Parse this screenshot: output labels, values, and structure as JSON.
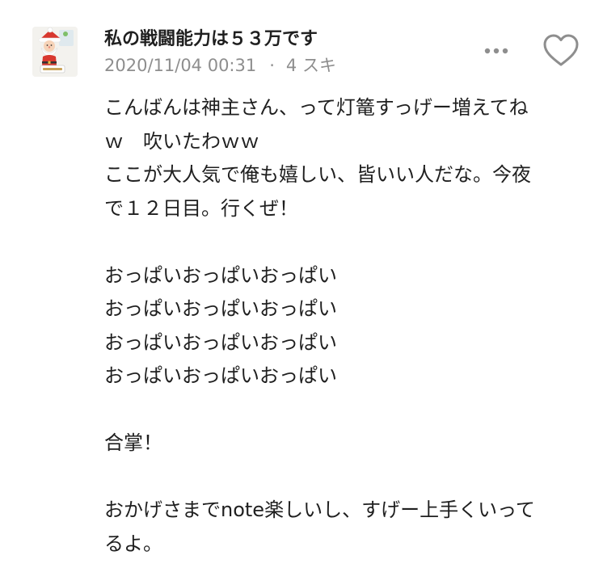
{
  "comment": {
    "author_name": "私の戦闘能力は５３万です",
    "timestamp": "2020/11/04 00:31",
    "separator": "·",
    "likes_label": "4 スキ",
    "body_lines": [
      "こんばんは神主さん、って灯篭すっげー増えてね",
      "ｗ　吹いたわｗｗ",
      "ここが大人気で俺も嬉しい、皆いい人だな。今夜",
      "で１２日目。行くぜ！",
      "",
      "おっぱいおっぱいおっぱい",
      "おっぱいおっぱいおっぱい",
      "おっぱいおっぱいおっぱい",
      "おっぱいおっぱいおっぱい",
      "",
      "合掌！",
      "",
      "おかげさまでnote楽しいし、すげー上手くいって",
      "るよ。"
    ]
  },
  "colors": {
    "text": "#1f1f1f",
    "meta": "#8e8e8e",
    "icon": "#8e8e8e",
    "background": "#ffffff"
  },
  "icons": {
    "avatar": "santa-claus-avatar",
    "more": "more-options-icon",
    "like": "heart-outline-icon"
  }
}
